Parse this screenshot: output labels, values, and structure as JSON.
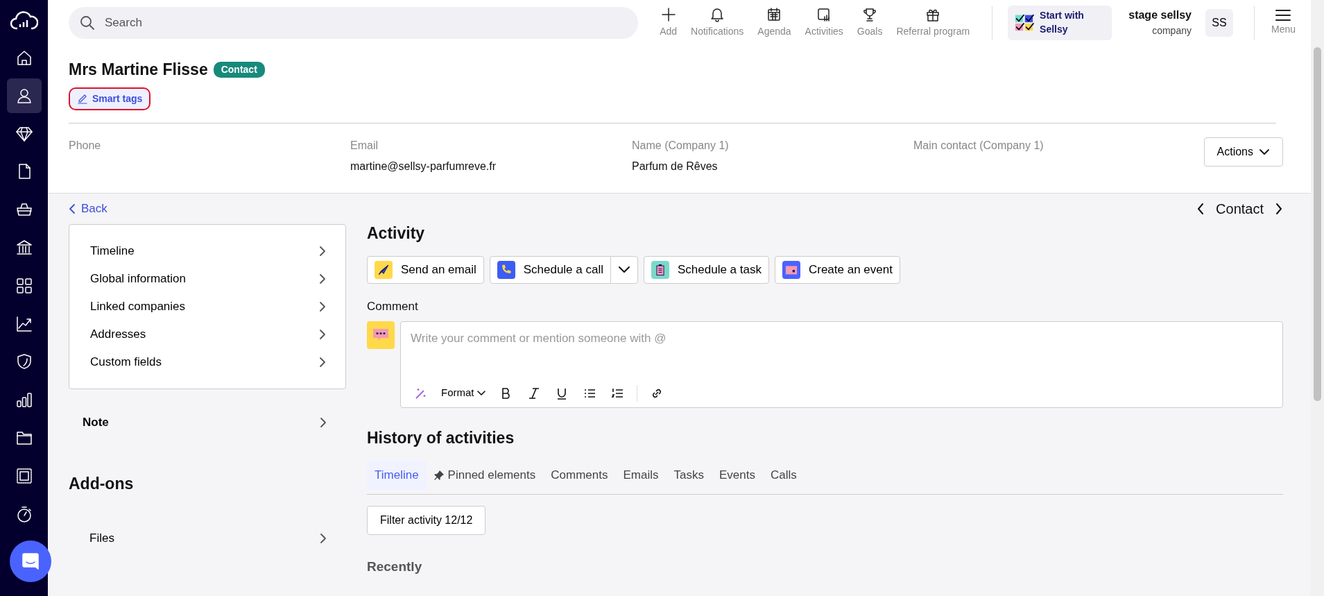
{
  "sidebar": {
    "items": [
      {
        "selected": false
      },
      {
        "selected": true
      },
      {
        "selected": false
      },
      {
        "selected": false
      },
      {
        "selected": false
      },
      {
        "selected": false
      },
      {
        "selected": false
      },
      {
        "selected": false
      },
      {
        "selected": false
      },
      {
        "selected": false
      },
      {
        "selected": false
      },
      {
        "selected": false
      },
      {
        "selected": false
      }
    ]
  },
  "topbar": {
    "search": {
      "placeholder": "Search"
    },
    "actions": [
      "Add",
      "Notifications",
      "Agenda",
      "Activities",
      "Goals",
      "Referral program"
    ],
    "start": "Start with Sellsy",
    "account": {
      "name": "stage sellsy",
      "type": "company",
      "initials": "SS"
    },
    "menu": "Menu"
  },
  "contact": {
    "title": "Mrs Martine Flisse",
    "badge": "Contact",
    "smart_tags": "Smart tags",
    "fields": [
      {
        "label": "Phone"
      },
      {
        "label": "Email",
        "value": "martine@sellsy-parfumreve.fr"
      },
      {
        "label": "Name (Company 1)",
        "value": "Parfum de Rêves"
      },
      {
        "label": "Main contact (Company 1)"
      }
    ],
    "actions": "Actions"
  },
  "back": "Back",
  "pager": "Contact",
  "menu_card": [
    "Timeline",
    "Global information",
    "Linked companies",
    "Addresses",
    "Custom fields"
  ],
  "note": "Note",
  "addons": {
    "title": "Add-ons",
    "items": [
      "Files"
    ]
  },
  "activity": {
    "title": "Activity",
    "buttons": [
      "Send an email",
      "Schedule a call",
      "Schedule a task",
      "Create an event"
    ],
    "comment_label": "Comment",
    "comment": {
      "placeholder": "Write your comment or mention someone with @"
    },
    "format": "Format"
  },
  "history": {
    "title": "History of activities",
    "tabs": [
      {
        "label": "Timeline",
        "selected": true
      },
      {
        "label": "Pinned elements",
        "selected": false
      },
      {
        "label": "Comments",
        "selected": false
      },
      {
        "label": "Emails",
        "selected": false
      },
      {
        "label": "Tasks",
        "selected": false
      },
      {
        "label": "Events",
        "selected": false
      },
      {
        "label": "Calls",
        "selected": false
      }
    ],
    "filter": "Filter activity 12/12",
    "section": "Recently"
  }
}
